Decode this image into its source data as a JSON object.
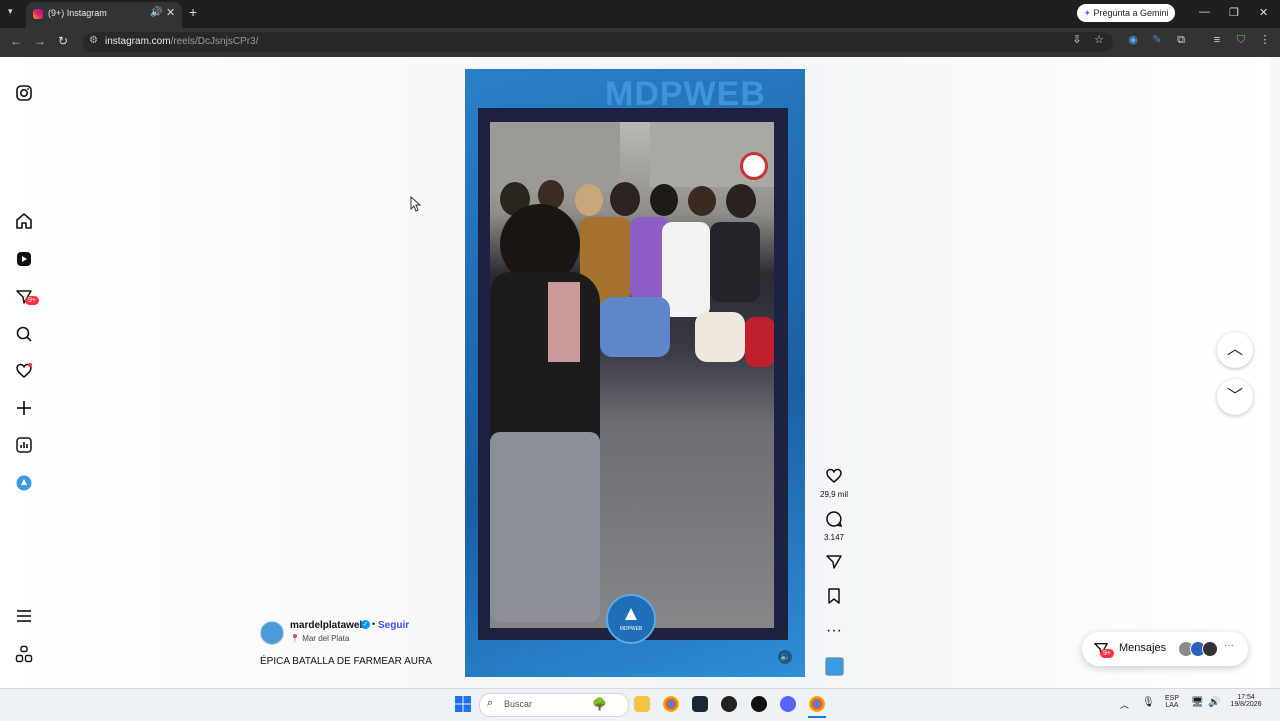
{
  "browser": {
    "tab_title": "(9+) Instagram",
    "new_tab": "+",
    "url_host": "instagram.com",
    "url_path": "/reels/DcJsnjsCPr3/",
    "gemini_button": "Pregunta a Gemini",
    "window_controls": {
      "minimize": "—",
      "restore": "❐",
      "close": "✕"
    }
  },
  "sidebar": {
    "notifications_badge": "9+",
    "icons": [
      "instagram-logo-icon",
      "home-icon",
      "reels-icon",
      "messages-icon",
      "search-icon",
      "notifications-icon",
      "create-icon",
      "dashboard-icon",
      "profile-icon",
      "menu-icon",
      "more-apps-icon"
    ]
  },
  "reel": {
    "watermark": "MDPWEB",
    "logo_text": "MDPWEB",
    "likes": "29,9 mil",
    "comments": "3.147"
  },
  "post": {
    "username": "mardelplataweb",
    "follow": "Seguir",
    "location": "Mar del Plata",
    "caption": "ÉPICA BATALLA DE FARMEAR AURA",
    "separator": "•"
  },
  "messages": {
    "label": "Mensajes",
    "badge": "9+"
  },
  "taskbar": {
    "search_placeholder": "Buscar",
    "language_top": "ESP",
    "language_bottom": "LAA",
    "time": "17:54",
    "date": "19/8/2026"
  },
  "colors": {
    "accent_blue": "#4150f7",
    "badge_red": "#ff3040",
    "reel_blue": "#1b5fa6"
  }
}
